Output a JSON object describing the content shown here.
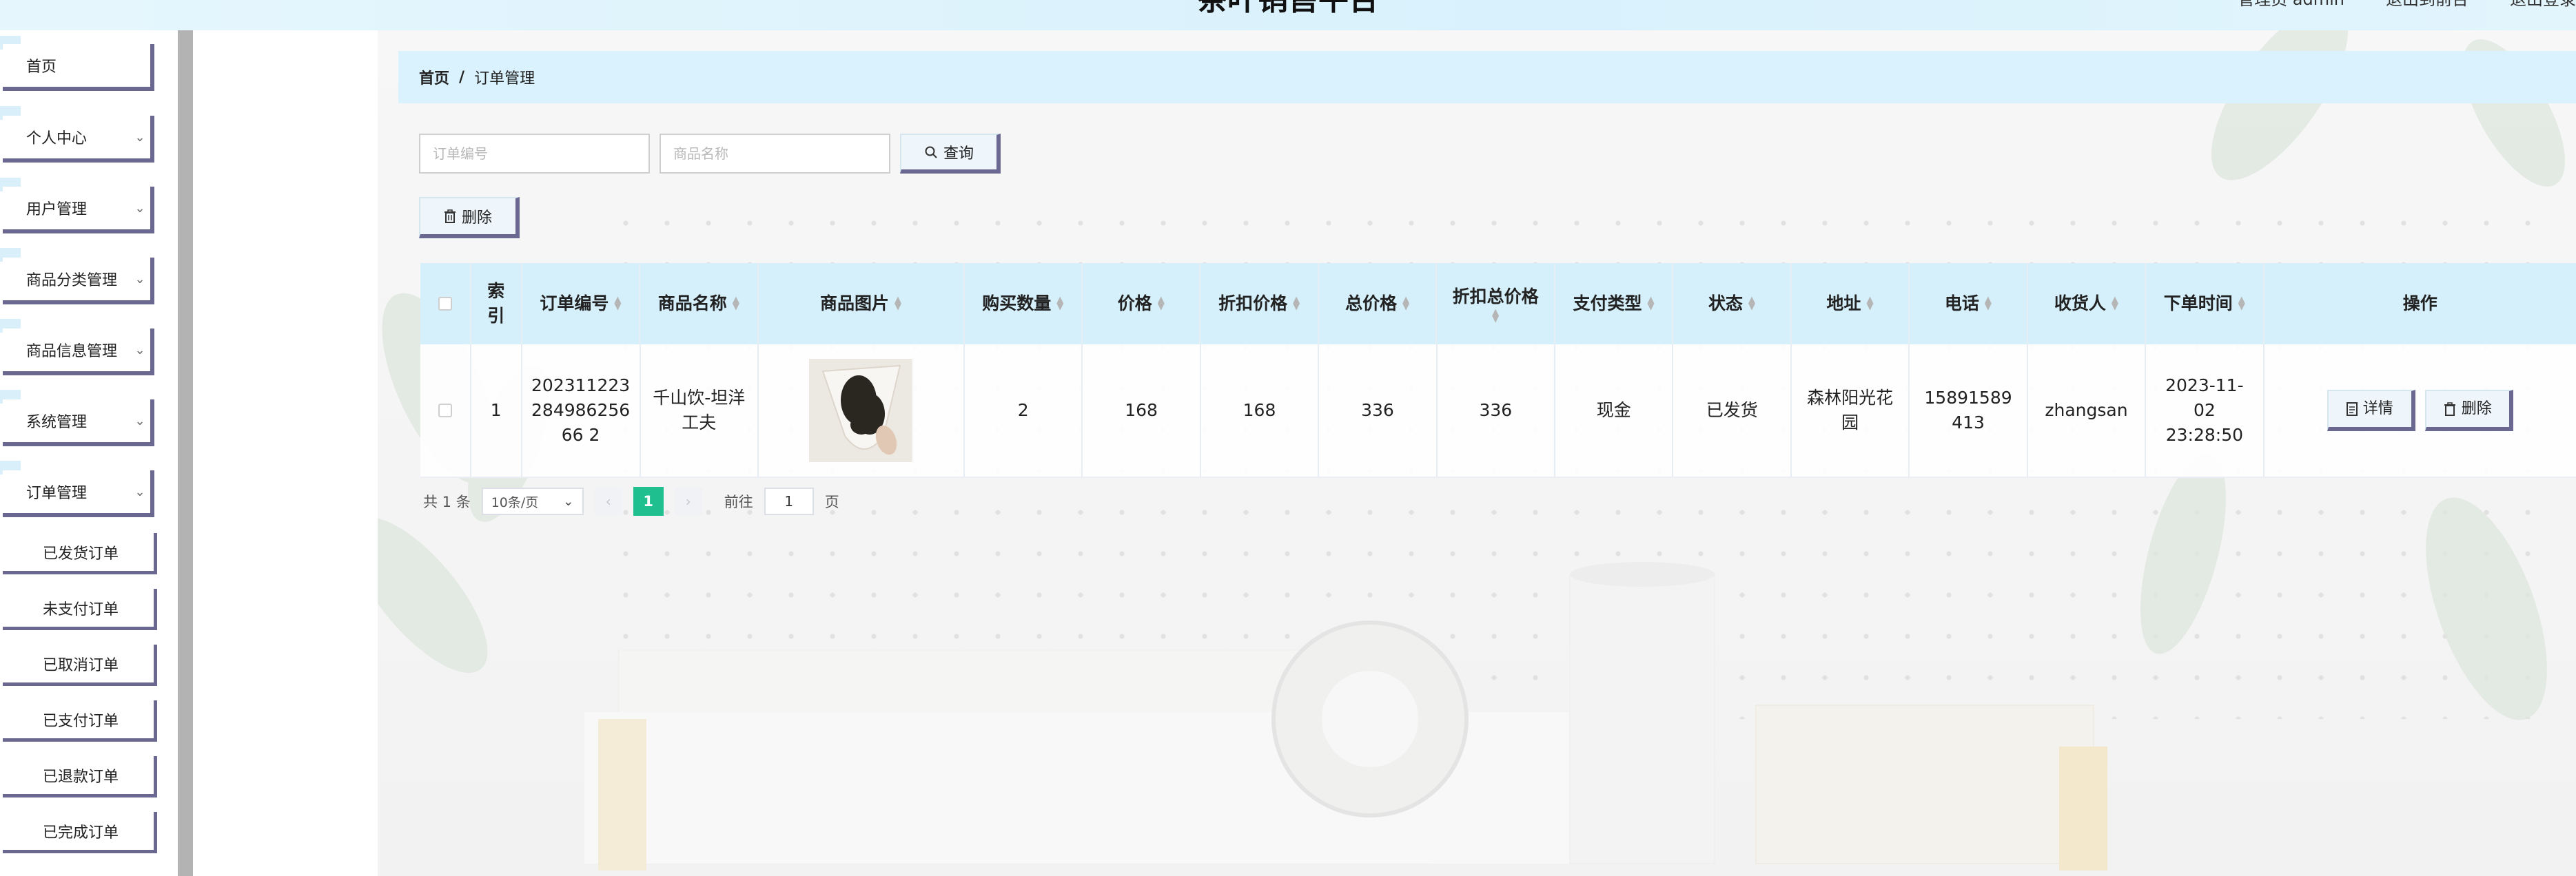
{
  "header": {
    "title": "茶叶销售平台",
    "admin_label": "管理员 admin",
    "to_front_label": "退出到前台",
    "logout_label": "退出登录"
  },
  "sidebar": {
    "items": [
      {
        "label": "首页",
        "expandable": false
      },
      {
        "label": "个人中心",
        "expandable": true
      },
      {
        "label": "用户管理",
        "expandable": true
      },
      {
        "label": "商品分类管理",
        "expandable": true
      },
      {
        "label": "商品信息管理",
        "expandable": true
      },
      {
        "label": "系统管理",
        "expandable": true
      },
      {
        "label": "订单管理",
        "expandable": true
      }
    ],
    "sub_items": [
      {
        "label": "已发货订单"
      },
      {
        "label": "未支付订单"
      },
      {
        "label": "已取消订单"
      },
      {
        "label": "已支付订单"
      },
      {
        "label": "已退款订单"
      },
      {
        "label": "已完成订单"
      }
    ]
  },
  "breadcrumb": {
    "home": "首页",
    "separator": "/",
    "current": "订单管理"
  },
  "search": {
    "order_no_placeholder": "订单编号",
    "product_name_placeholder": "商品名称",
    "query_label": "查询",
    "delete_label": "删除"
  },
  "table": {
    "headers": {
      "index": "索引",
      "order_no": "订单编号",
      "product_name": "商品名称",
      "product_image": "商品图片",
      "quantity": "购买数量",
      "price": "价格",
      "discount_price": "折扣价格",
      "total_price": "总价格",
      "discount_total": "折扣总价格",
      "payment_type": "支付类型",
      "status": "状态",
      "address": "地址",
      "phone": "电话",
      "receiver": "收货人",
      "order_time": "下单时间",
      "actions": "操作"
    },
    "rows": [
      {
        "index": "1",
        "order_no": "20231122328498625666 2",
        "product_name": "千山饮-坦洋工夫",
        "quantity": "2",
        "price": "168",
        "discount_price": "168",
        "total_price": "336",
        "discount_total": "336",
        "payment_type": "现金",
        "status": "已发货",
        "address": "森林阳光花园",
        "phone": "15891589413",
        "receiver": "zhangsan",
        "order_time": "2023-11-02 23:28:50",
        "detail_label": "详情",
        "delete_label": "删除"
      }
    ]
  },
  "pagination": {
    "total_text": "共 1 条",
    "page_size": "10条/页",
    "current_page": "1",
    "goto_prefix": "前往",
    "goto_value": "1",
    "goto_suffix": "页"
  },
  "colors": {
    "accent": "#1fbf8f",
    "header_bg": "#d6f0fb",
    "button_shadow": "#6a6890"
  }
}
